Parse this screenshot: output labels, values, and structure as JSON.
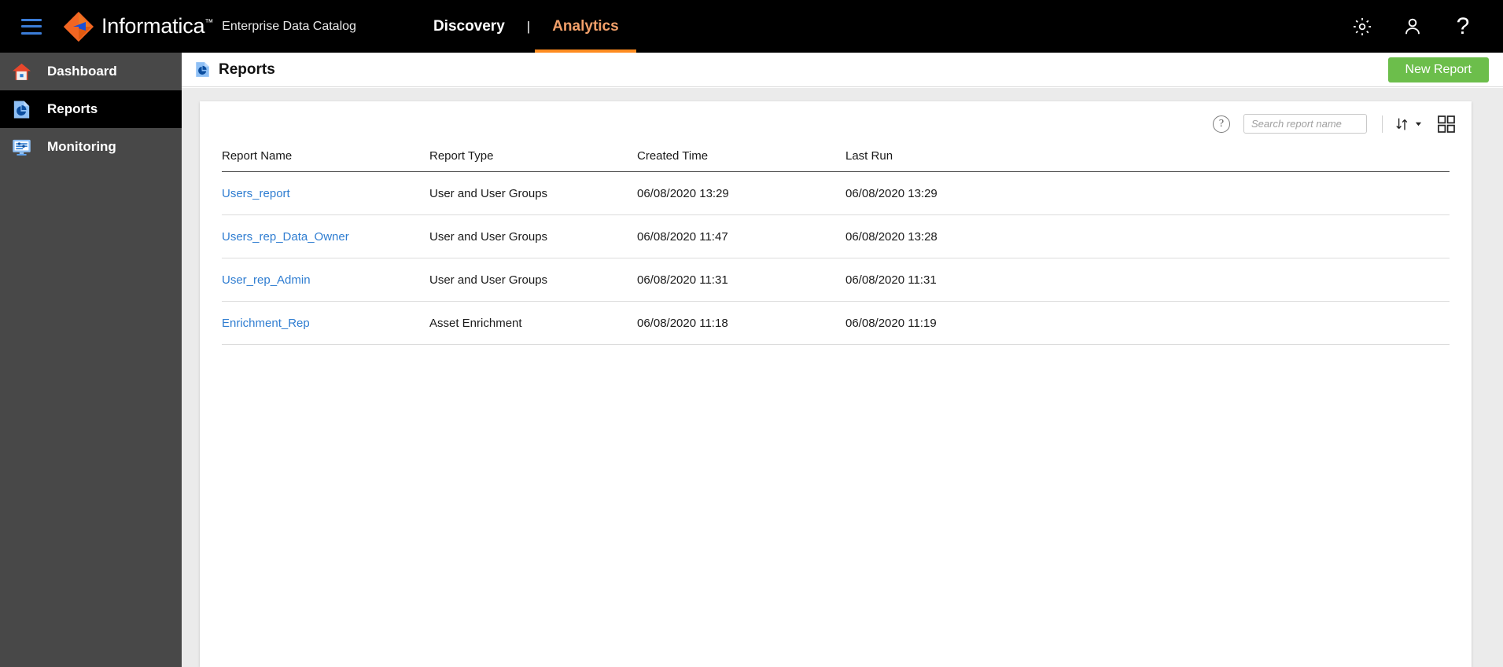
{
  "header": {
    "menu_icon": "hamburger-menu-icon",
    "brand": "Informatica",
    "brand_tm": "™",
    "product": "Enterprise Data Catalog",
    "tabs": [
      {
        "label": "Discovery",
        "active": false
      },
      {
        "label": "Analytics",
        "active": true
      }
    ],
    "tab_separator": "|",
    "icons": [
      {
        "name": "gear-icon",
        "glyph": "⚙"
      },
      {
        "name": "user-icon",
        "glyph": "👤"
      },
      {
        "name": "help-icon",
        "glyph": "?"
      }
    ]
  },
  "sidebar": {
    "items": [
      {
        "label": "Dashboard",
        "icon": "home-icon",
        "selected": false
      },
      {
        "label": "Reports",
        "icon": "reports-pie-icon",
        "selected": true
      },
      {
        "label": "Monitoring",
        "icon": "monitor-icon",
        "selected": false
      }
    ]
  },
  "page": {
    "title": "Reports",
    "title_icon": "reports-pie-icon",
    "new_report_button": "New Report"
  },
  "toolbar": {
    "help_glyph": "?",
    "search_placeholder": "Search report name",
    "search_value": "",
    "sort_icon": "sort-arrows-icon",
    "grid_icon": "grid-view-icon"
  },
  "table": {
    "columns": [
      "Report Name",
      "Report Type",
      "Created Time",
      "Last Run"
    ],
    "rows": [
      {
        "name": "Users_report",
        "type": "User and User Groups",
        "created": "06/08/2020 13:29",
        "last_run": "06/08/2020 13:29"
      },
      {
        "name": "Users_rep_Data_Owner",
        "type": "User and User Groups",
        "created": "06/08/2020 11:47",
        "last_run": "06/08/2020 13:28"
      },
      {
        "name": "User_rep_Admin",
        "type": "User and User Groups",
        "created": "06/08/2020 11:31",
        "last_run": "06/08/2020 11:31"
      },
      {
        "name": "Enrichment_Rep",
        "type": "Asset Enrichment",
        "created": "06/08/2020 11:18",
        "last_run": "06/08/2020 11:19"
      }
    ]
  },
  "colors": {
    "brand_orange": "#ff8b1f",
    "accent_blue": "#2f7dd1",
    "button_green": "#6cbe4b",
    "header_black": "#000000",
    "sidebar_gray": "#484848"
  }
}
